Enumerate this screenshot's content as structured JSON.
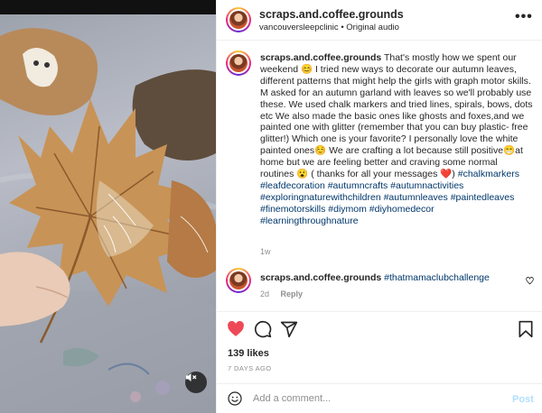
{
  "media": {
    "mute_icon": "speaker-muted-icon"
  },
  "header": {
    "username": "scraps.and.coffee.grounds",
    "account": "vancouversleepclinic",
    "separator": "•",
    "audio": "Original audio",
    "more_icon": "more-options-icon",
    "more": "•••"
  },
  "caption": {
    "username": "scraps.and.coffee.grounds",
    "text": "That's mostly how we spent our weekend 😊 I tried new ways to decorate our autumn leaves, different patterns that might help the girls with graph motor skills. M asked for an autumn garland with leaves so we'll probably use these. We used chalk markers and tried lines, spirals, bows, dots etc We also made the basic ones like ghosts and foxes,and we painted one with glitter (remember that you can buy plastic- free glitter!) Which one is your favorite? I personally love the white painted ones☺️ We are crafting a lot because still positive😁at home but we are feeling better and craving some normal routines 😮 ( thanks for all your messages ❤️) ",
    "hashtags": "#chalkmarkers #leafdecoration #autumncrafts #autumnactivities #exploringnaturewithchildren #autumnleaves #paintedleaves #finemotorskills #diymom #diyhomedecor #learningthroughnature",
    "time": "1w"
  },
  "comment": {
    "username": "scraps.and.coffee.grounds",
    "text": "#thatmamaclubchallenge",
    "time": "2d",
    "reply": "Reply"
  },
  "actions": {
    "like_icon": "heart-filled-icon",
    "comment_icon": "comment-bubble-icon",
    "share_icon": "paper-plane-icon",
    "save_icon": "bookmark-icon",
    "like_color": "#ed4956"
  },
  "likes": "139 likes",
  "date": "7 DAYS AGO",
  "compose": {
    "placeholder": "Add a comment...",
    "post": "Post",
    "emoji_icon": "emoji-smiley-icon"
  }
}
